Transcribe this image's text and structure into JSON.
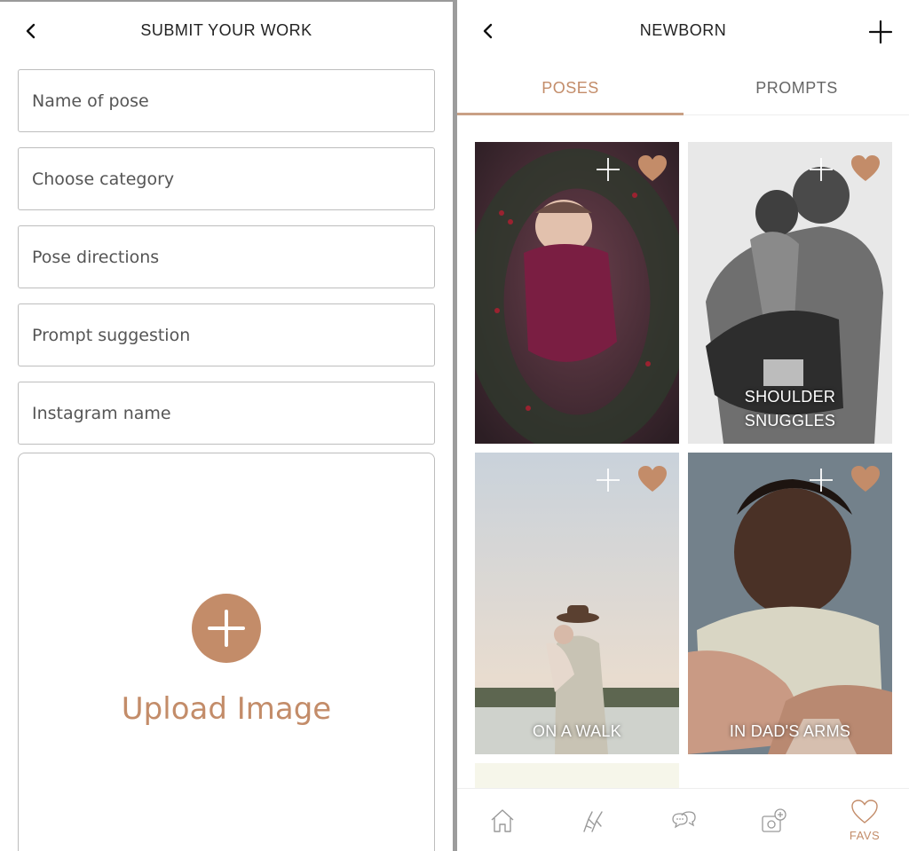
{
  "left_screen": {
    "title": "SUBMIT YOUR WORK",
    "fields": [
      {
        "placeholder": "Name of pose"
      },
      {
        "placeholder": "Choose category"
      },
      {
        "placeholder": "Pose directions"
      },
      {
        "placeholder": "Prompt suggestion"
      },
      {
        "placeholder": "Instagram name"
      }
    ],
    "upload_label": "Upload Image"
  },
  "right_screen": {
    "title": "NEWBORN",
    "tabs": [
      {
        "label": "POSES",
        "active": true
      },
      {
        "label": "PROMPTS",
        "active": false
      }
    ],
    "cards": [
      {
        "caption": "",
        "favorited": true
      },
      {
        "caption_line1": "SHOULDER",
        "caption_line2": "SNUGGLES",
        "favorited": true
      },
      {
        "caption": "ON A WALK",
        "favorited": true
      },
      {
        "caption": "IN DAD'S ARMS",
        "favorited": true
      }
    ],
    "bottom_nav": [
      {
        "icon": "home-icon",
        "label": ""
      },
      {
        "icon": "hands-pose-icon",
        "label": ""
      },
      {
        "icon": "chat-bubbles-icon",
        "label": ""
      },
      {
        "icon": "add-photo-icon",
        "label": ""
      },
      {
        "icon": "heart-icon",
        "label": "FAVS"
      }
    ]
  },
  "colors": {
    "accent": "#c38c69",
    "border": "#bdbdbd",
    "divider": "#9c9c9c"
  }
}
